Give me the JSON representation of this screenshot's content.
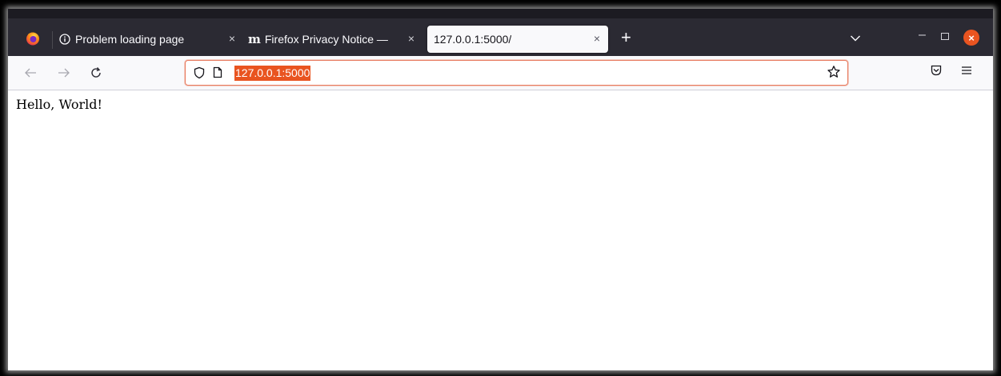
{
  "browser": {
    "tabs": [
      {
        "title": "Problem loading page",
        "icon": "info-icon",
        "active": false
      },
      {
        "title": "Firefox Privacy Notice —",
        "icon": "m-icon",
        "icon_text": "m",
        "active": false
      },
      {
        "title": "127.0.0.1:5000/",
        "icon": "",
        "active": true
      }
    ],
    "tab_close_glyph": "×",
    "new_tab_glyph": "+",
    "window_controls": {
      "minimize": "–",
      "close": "×"
    },
    "url": "127.0.0.1:5000",
    "accent_color": "#e95420"
  },
  "page": {
    "text": "Hello, World!"
  }
}
